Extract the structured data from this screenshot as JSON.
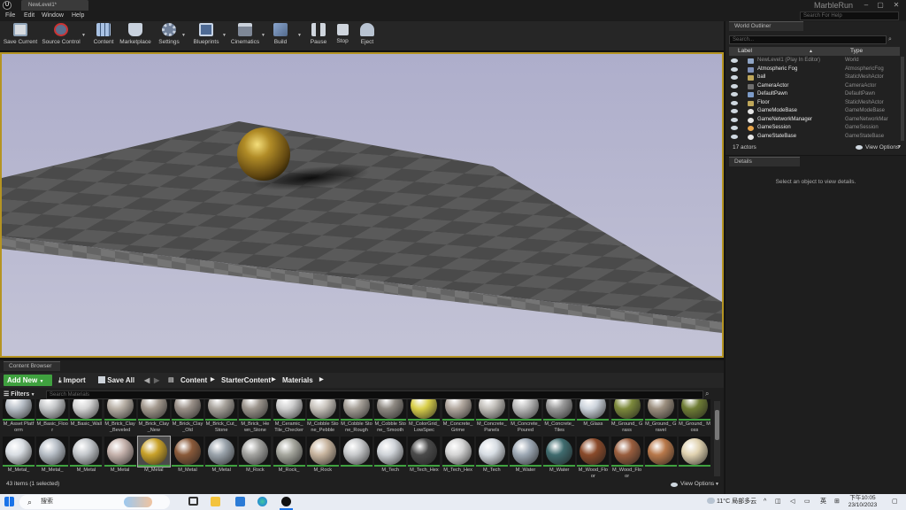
{
  "window": {
    "level_tab": "NewLevel1*",
    "project_name": "MarbleRun",
    "help_search_placeholder": "Search For Help",
    "controls": [
      "–",
      "▢",
      "✕"
    ]
  },
  "menu": [
    "File",
    "Edit",
    "Window",
    "Help"
  ],
  "toolbar": {
    "buttons": [
      {
        "label": "Save Current",
        "icon": "save-icon"
      },
      {
        "label": "Source Control",
        "icon": "source-control-icon"
      },
      {
        "label": "Content",
        "icon": "content-icon"
      },
      {
        "label": "Marketplace",
        "icon": "marketplace-icon"
      },
      {
        "label": "Settings",
        "icon": "settings-icon"
      },
      {
        "label": "Blueprints",
        "icon": "blueprints-icon"
      },
      {
        "label": "Cinematics",
        "icon": "cinematics-icon"
      },
      {
        "label": "Build",
        "icon": "build-icon"
      },
      {
        "label": "Pause",
        "icon": "pause-icon"
      },
      {
        "label": "Stop",
        "icon": "stop-icon"
      },
      {
        "label": "Eject",
        "icon": "eject-icon"
      }
    ]
  },
  "colors": {
    "accent_green": "#3fa13f",
    "viewport_border": "#b59422",
    "sky": "#b3b3cb"
  },
  "outliner": {
    "tab": "World Outliner",
    "search_placeholder": "Search...",
    "col_label": "Label",
    "col_type": "Type",
    "rows": [
      {
        "label": "NewLevel1 (Play In Editor)",
        "type": "World"
      },
      {
        "label": "Atmospheric Fog",
        "type": "AtmosphericFog"
      },
      {
        "label": "ball",
        "type": "StaticMeshActor"
      },
      {
        "label": "CameraActor",
        "type": "CameraActor"
      },
      {
        "label": "DefaultPawn",
        "type": "DefaultPawn"
      },
      {
        "label": "Floor",
        "type": "StaticMeshActor"
      },
      {
        "label": "GameModeBase",
        "type": "GameModeBase"
      },
      {
        "label": "GameNetworkManager",
        "type": "GameNetworkMar"
      },
      {
        "label": "GameSession",
        "type": "GameSession"
      },
      {
        "label": "GameStateBase",
        "type": "GameStateBase"
      }
    ],
    "actor_count": "17 actors",
    "view_options": "View Options"
  },
  "details": {
    "tab": "Details",
    "empty_text": "Select an object to view details."
  },
  "content_browser": {
    "tab": "Content Browser",
    "add_new": "Add New",
    "import": "Import",
    "save_all": "Save All",
    "breadcrumbs": [
      "Content",
      "StarterContent",
      "Materials"
    ],
    "filters": "Filters",
    "search_placeholder": "Search Materials",
    "row1": [
      {
        "name": "M_Asset Platform",
        "color": "#b9c0c8"
      },
      {
        "name": "M_Basic_Floor",
        "color": "#c5c7c9"
      },
      {
        "name": "M_Basic_Wall",
        "color": "#d6d6d6"
      },
      {
        "name": "M_Brick_Clay _Beveled",
        "color": "#b8b0a6"
      },
      {
        "name": "M_Brick_Clay _New",
        "color": "#a49a8f"
      },
      {
        "name": "M_Brick_Clay _Old",
        "color": "#9b9189"
      },
      {
        "name": "M_Brick_Cut_ Stone",
        "color": "#a8a39c"
      },
      {
        "name": "M_Brick_ Hewn_Stone",
        "color": "#9c958d"
      },
      {
        "name": "M_Ceramic_ Tile_Checker",
        "color": "#cfcfcf"
      },
      {
        "name": "M_Cobble Stone_Pebble",
        "color": "#c9c4bd"
      },
      {
        "name": "M_Cobble Stone_Rough",
        "color": "#a6a098"
      },
      {
        "name": "M_Cobble Stone_ Smooth",
        "color": "#8f8a83"
      },
      {
        "name": "M_ColorGrid_ LowSpec",
        "color": "#d9cf4a"
      },
      {
        "name": "M_Concrete_ Grime",
        "color": "#b2a89f"
      },
      {
        "name": "M_Concrete_ Panels",
        "color": "#c2bfba"
      },
      {
        "name": "M_Concrete_ Poured",
        "color": "#bcbcbc"
      },
      {
        "name": "M_Concrete_ Tiles",
        "color": "#9a9a9a"
      },
      {
        "name": "M_Glass",
        "color": "#cdd4dc"
      },
      {
        "name": "M_Ground_ Grass",
        "color": "#7d8a3c"
      },
      {
        "name": "M_Ground_ Gravel",
        "color": "#9c8f7f"
      },
      {
        "name": "M_Ground_ Moss",
        "color": "#6f7d35"
      }
    ],
    "row2": [
      {
        "name": "M_Metal_",
        "color": "#d8dde2",
        "selected": false
      },
      {
        "name": "M_Metal_",
        "color": "#b7bec6",
        "selected": false
      },
      {
        "name": "M_Metal",
        "color": "#c3c7cb",
        "selected": false
      },
      {
        "name": "M_Metal",
        "color": "#c5b2ac",
        "selected": false
      },
      {
        "name": "M_Metal",
        "color": "#c9a22a",
        "selected": true
      },
      {
        "name": "M_Metal",
        "color": "#8a5a3a",
        "selected": false
      },
      {
        "name": "M_Metal",
        "color": "#9aa3ab",
        "selected": false
      },
      {
        "name": "M_Rock",
        "color": "#a3a3a0",
        "selected": false
      },
      {
        "name": "M_Rock_",
        "color": "#a6a79e",
        "selected": false
      },
      {
        "name": "M_Rock",
        "color": "#c8b59f",
        "selected": false
      },
      {
        "name": "",
        "color": "#c7c9cb",
        "selected": false
      },
      {
        "name": "M_Tech",
        "color": "#cfd3d8",
        "selected": false
      },
      {
        "name": "M_Tech_Hex",
        "color": "#4a4a4a",
        "selected": false
      },
      {
        "name": "M_Tech_Hex",
        "color": "#d4d4d4",
        "selected": false
      },
      {
        "name": "M_Tech",
        "color": "#d7dde3",
        "selected": false
      },
      {
        "name": "M_Water",
        "color": "#9ea9b5",
        "selected": false
      },
      {
        "name": "M_Water",
        "color": "#3f6b6e",
        "selected": false
      },
      {
        "name": "M_Wood_Floor",
        "color": "#8a4a2a",
        "selected": false
      },
      {
        "name": "M_Wood_Floor",
        "color": "#9a5e3e",
        "selected": false
      },
      {
        "name": "",
        "color": "#b8784a",
        "selected": false
      },
      {
        "name": "",
        "color": "#e0d2b0",
        "selected": false
      }
    ],
    "status": "43 items (1 selected)",
    "view_options": "View Options"
  },
  "taskbar": {
    "search_text": "搜索",
    "weather": "11°C 局部多云",
    "ime": "英",
    "time": "下午10:05",
    "date": "23/10/2023"
  }
}
